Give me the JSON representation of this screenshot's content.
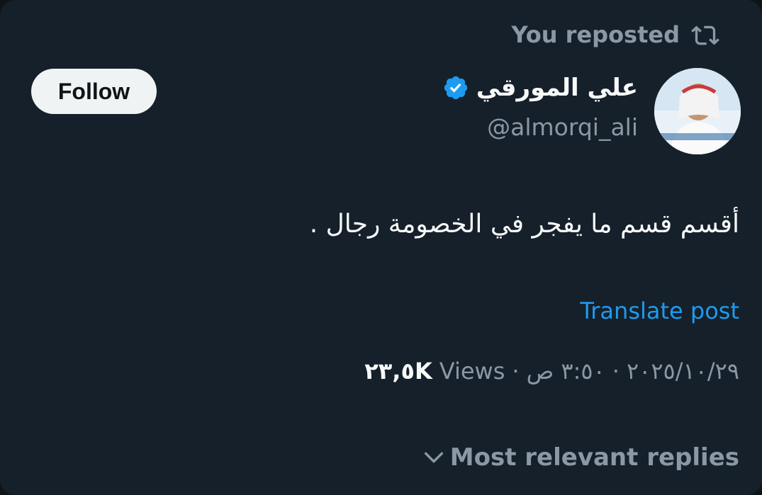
{
  "repost": {
    "label": "You reposted",
    "icon": "repost-icon"
  },
  "follow_button": {
    "label": "Follow"
  },
  "author": {
    "display_name": "علي المورقي",
    "handle": "@almorqi_ali",
    "verified_icon": "verified-badge-icon",
    "avatar_icon": "avatar-photo"
  },
  "post": {
    "text": "أقسم قسم ما يفجر في الخصومة رجال ."
  },
  "translate": {
    "label": "Translate post"
  },
  "meta": {
    "date": "٢٠٢٥/١٠/٢٩",
    "separator1": "·",
    "time": "٣:٥٠ ص",
    "separator2": "·",
    "views_count": "٢٣,٥K",
    "views_label": "Views"
  },
  "replies": {
    "label": "Most relevant replies",
    "icon": "chevron-down-icon"
  },
  "colors": {
    "background": "#15202b",
    "accent": "#1d9bf0",
    "muted": "#8b98a5",
    "text": "#f7f9f9"
  }
}
